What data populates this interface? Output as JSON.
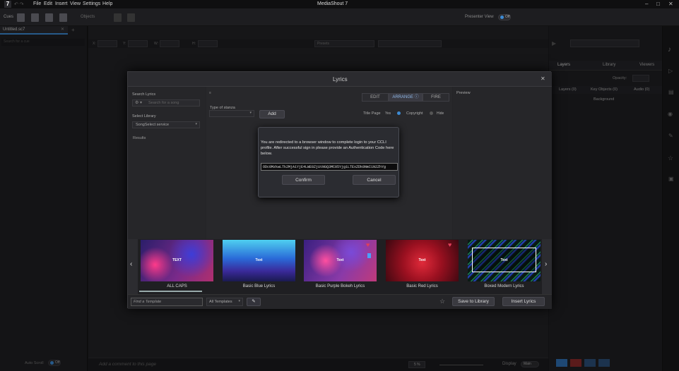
{
  "app": {
    "title": "MediaShout 7",
    "logo": "7"
  },
  "menu": [
    "File",
    "Edit",
    "Insert",
    "View",
    "Settings",
    "Help"
  ],
  "toolbar": {
    "cues_label": "Cues",
    "objects_label": "Objects",
    "presenter_view_label": "Presenter View",
    "presenter_view_state": "Off"
  },
  "left": {
    "tab_label": "Untitled.sc7",
    "search_placeholder": "Search for a cue",
    "autoscroll_label": "Auto Scroll",
    "autoscroll_state": "Off"
  },
  "props": {
    "x": "X:",
    "y": "Y:",
    "w": "W:",
    "h": "H:",
    "presets": "Presets"
  },
  "right": {
    "tabs": [
      "Layers",
      "Library",
      "Viewers"
    ],
    "opacity_label": "Opacity:",
    "cols": [
      "Layers (0)",
      "Key Objects (0)",
      "Audio (0)"
    ],
    "background": "Background"
  },
  "dialog": {
    "title": "Lyrics",
    "search_lyrics_label": "Search Lyrics",
    "search_placeholder": "Search for a song",
    "select_library_label": "Select Library",
    "library_value": "SongSelect service",
    "results_label": "Results",
    "type_of_stanza_label": "Type of stanza",
    "add_label": "Add",
    "tabs": [
      "EDIT",
      "ARRANGE",
      "FIRE"
    ],
    "title_page_label": "Title Page",
    "title_page_value": "Yes",
    "copyright_label": "Copyright",
    "copyright_value": "Hide",
    "preview_label": "Preview",
    "auth": {
      "message": "You are redirected to a browser window to complete login to your CCLI profile. After successful sign in please provide an Authentication Code here below.",
      "code": "ODc0MzkwLTk2MjA1YjE4LWE0ZjUtNGQ3MC05Yjg1LTExZDk0NmI1N2ZhYg",
      "confirm": "Confirm",
      "cancel": "Cancel"
    },
    "templates": [
      {
        "name": "ALL CAPS",
        "text": "TEXT"
      },
      {
        "name": "Basic Blue Lyrics",
        "text": "Text"
      },
      {
        "name": "Basic Purple Bokeh Lyrics",
        "text": "Text"
      },
      {
        "name": "Basic Red Lyrics",
        "text": "Text"
      },
      {
        "name": "Boxed Modern Lyrics",
        "text": "Text"
      }
    ],
    "find_template_placeholder": "Find a Template",
    "all_templates": "All Templates",
    "save_to_library": "Save to Library",
    "insert_lyrics": "Insert Lyrics"
  },
  "status": {
    "comment_placeholder": "Add a comment to this page",
    "zoom": "5 %",
    "display_label": "Display",
    "display_value": "Main"
  },
  "colors": {
    "accent": "#3d8bd4",
    "heart": "#e0405a"
  }
}
